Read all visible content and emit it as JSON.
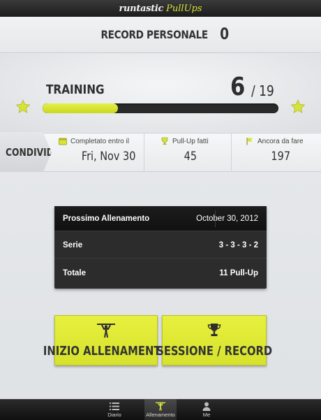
{
  "app": {
    "brand": "runtastic",
    "product": "PullUps",
    "accent": "#d7e33a"
  },
  "record": {
    "label": "RECORD PERSONALE",
    "value": "0"
  },
  "training": {
    "label": "TRAINING",
    "done": "6",
    "total": "/ 19",
    "progress_fraction": 0.32
  },
  "stats": {
    "share_label": "CONDIVIDI",
    "items": [
      {
        "label": "Completato entro il",
        "value": "Fri, Nov 30",
        "icon": "calendar-icon"
      },
      {
        "label": "Pull-Up fatti",
        "value": "45",
        "icon": "trophy-icon"
      },
      {
        "label": "Ancora da fare",
        "value": "197",
        "icon": "flag-icon"
      }
    ]
  },
  "next_workout": {
    "title": "Prossimo Allenamento",
    "date": "October 30, 2012",
    "rows": [
      {
        "label": "Serie",
        "value": "3 - 3 - 3 - 2"
      },
      {
        "label": "Totale",
        "value": "11 Pull-Up"
      }
    ]
  },
  "actions": {
    "start": {
      "label": "INIZIO ALLENAMENTO",
      "icon": "pullup-icon"
    },
    "session": {
      "label": "SESSIONE / RECORD",
      "icon": "trophy-icon"
    }
  },
  "tabs": [
    {
      "label": "Diario",
      "icon": "list-icon"
    },
    {
      "label": "Allenamento",
      "icon": "pullup-icon",
      "active": true
    },
    {
      "label": "Me",
      "icon": "person-icon"
    }
  ]
}
